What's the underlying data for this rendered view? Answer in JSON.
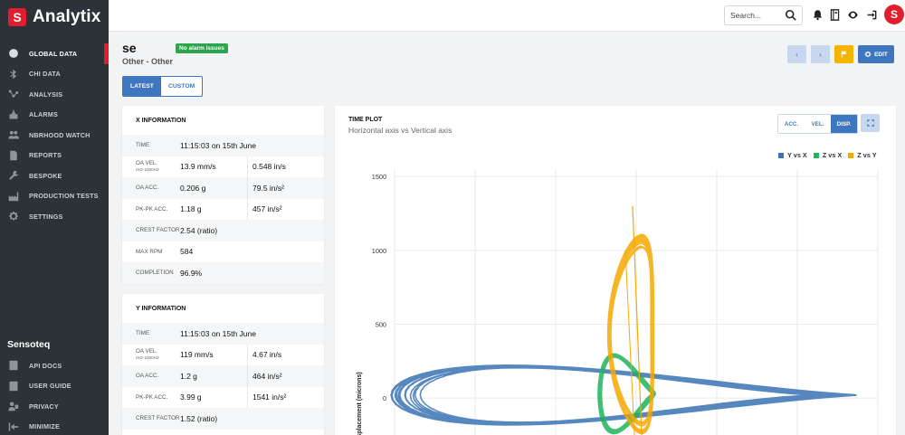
{
  "brand": {
    "name": "Analytix",
    "logo_letter": "S"
  },
  "sidebar": {
    "items": [
      {
        "label": "GLOBAL DATA",
        "icon": "globe-icon",
        "active": true
      },
      {
        "label": "CHI DATA",
        "icon": "bluetooth-icon"
      },
      {
        "label": "ANALYSIS",
        "icon": "analysis-icon"
      },
      {
        "label": "ALARMS",
        "icon": "alarm-icon"
      },
      {
        "label": "NBRHOOD WATCH",
        "icon": "people-icon"
      },
      {
        "label": "REPORTS",
        "icon": "report-icon"
      },
      {
        "label": "BESPOKE",
        "icon": "wrench-icon"
      },
      {
        "label": "PRODUCTION TESTS",
        "icon": "factory-icon"
      },
      {
        "label": "SETTINGS",
        "icon": "gear-icon"
      }
    ],
    "org_name": "Sensoteq",
    "bottom_items": [
      {
        "label": "API DOCS",
        "icon": "book-icon"
      },
      {
        "label": "USER GUIDE",
        "icon": "user-guide-icon"
      },
      {
        "label": "PRIVACY",
        "icon": "privacy-icon"
      },
      {
        "label": "MINIMIZE",
        "icon": "minimize-icon"
      }
    ]
  },
  "topbar": {
    "search_placeholder": "Search...",
    "avatar_letter": "S"
  },
  "header": {
    "title": "se",
    "badge": "No alarm issues",
    "breadcrumb": "Other - Other",
    "edit_label": "EDIT",
    "prev_glyph": "‹",
    "next_glyph": "›"
  },
  "tabs": [
    "LATEST",
    "CUSTOM"
  ],
  "x_info": {
    "title": "X INFORMATION",
    "rows": [
      {
        "label": "TIME",
        "v1": "11:15:03 on 15th June"
      },
      {
        "label": "OA VEL.",
        "sub": "ISO-1000HZ",
        "v1": "13.9 mm/s",
        "v2": "0.548 in/s"
      },
      {
        "label": "OA ACC.",
        "v1": "0.206 g",
        "v2": "79.5 in/s²"
      },
      {
        "label": "PK-PK ACC.",
        "v1": "1.18 g",
        "v2": "457 in/s²"
      },
      {
        "label": "CREST FACTOR",
        "v1": "2.54 (ratio)"
      },
      {
        "label": "MAX RPM",
        "v1": "584"
      },
      {
        "label": "COMPLETION",
        "v1": "96.9%"
      }
    ]
  },
  "y_info": {
    "title": "Y INFORMATION",
    "rows": [
      {
        "label": "TIME",
        "v1": "11:15:03 on 15th June"
      },
      {
        "label": "OA VEL.",
        "sub": "ISO-1000HZ",
        "v1": "119 mm/s",
        "v2": "4.67 in/s"
      },
      {
        "label": "OA ACC.",
        "v1": "1.2 g",
        "v2": "464 in/s²"
      },
      {
        "label": "PK-PK ACC.",
        "v1": "3.99 g",
        "v2": "1541 in/s²"
      },
      {
        "label": "CREST FACTOR",
        "v1": "1.52 (ratio)"
      }
    ]
  },
  "plot": {
    "title": "TIME PLOT",
    "subtitle": "Horizontal axis vs Vertical axis",
    "modes": [
      "ACC.",
      "VEL.",
      "DISP."
    ],
    "active_mode": "DISP."
  },
  "chart_data": {
    "type": "line",
    "ylabel": "Displacement (microns)",
    "yticks": [
      1500,
      1000,
      500,
      0
    ],
    "ylim": [
      -250,
      1550
    ],
    "xlim": [
      -1000,
      1000
    ],
    "grid": true,
    "legend_position": "top-right",
    "series": [
      {
        "name": "Y vs X",
        "color": "#3a72b4",
        "shape": "wide ellipse",
        "cx": -60,
        "cy": 20,
        "rx": 900,
        "ry": 150
      },
      {
        "name": "Z vs X",
        "color": "#1fb35a",
        "shape": "narrow loop",
        "cx": -40,
        "cy": 30,
        "rx": 110,
        "ry": 210
      },
      {
        "name": "Z vs Y",
        "color": "#f5a800",
        "shape": "tall loop",
        "cx": 0,
        "cy": 430,
        "rx": 90,
        "ry": 640
      }
    ]
  }
}
